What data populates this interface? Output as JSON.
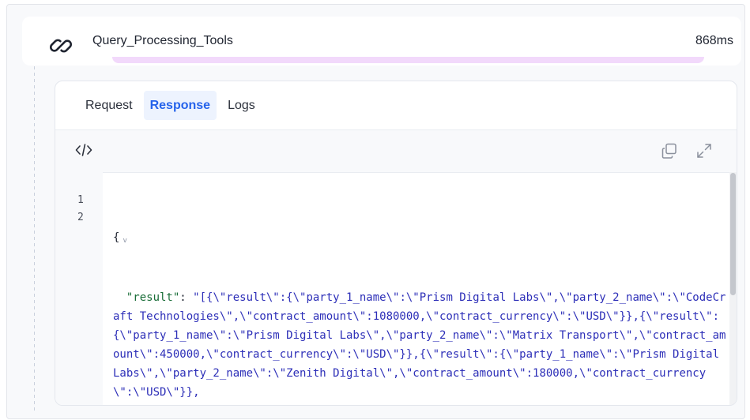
{
  "header": {
    "icon": "link-icon",
    "title": "Query_Processing_Tools",
    "duration": "868ms"
  },
  "tabs": [
    {
      "label": "Request",
      "active": false
    },
    {
      "label": "Response",
      "active": true
    },
    {
      "label": "Logs",
      "active": false
    }
  ],
  "toolbar": {
    "left_icon": "code-icon",
    "right_icons": [
      "copy-icon",
      "expand-icon"
    ]
  },
  "code": {
    "line_numbers": [
      "1",
      "2"
    ],
    "line1": "{",
    "fold_marker": "v",
    "key": "\"result\"",
    "colon": ": ",
    "value": "\"[{\\\"result\\\":{\\\"party_1_name\\\":\\\"Prism Digital Labs\\\",\\\"party_2_name\\\":\\\"CodeCraft Technologies\\\",\\\"contract_amount\\\":1080000,\\\"contract_currency\\\":\\\"USD\\\"}},{\\\"result\\\":{\\\"party_1_name\\\":\\\"Prism Digital Labs\\\",\\\"party_2_name\\\":\\\"Matrix Transport\\\",\\\"contract_amount\\\":450000,\\\"contract_currency\\\":\\\"USD\\\"}},{\\\"result\\\":{\\\"party_1_name\\\":\\\"Prism Digital Labs\\\",\\\"party_2_name\\\":\\\"Zenith Digital\\\",\\\"contract_amount\\\":180000,\\\"contract_currency\\\":\\\"USD\\\"}},"
  },
  "colors": {
    "accent": "#2563eb",
    "tab_active_bg": "#edf3fe",
    "string": "#2d2fb8",
    "key": "#1b6e39",
    "progress": "#f2d9fb"
  }
}
